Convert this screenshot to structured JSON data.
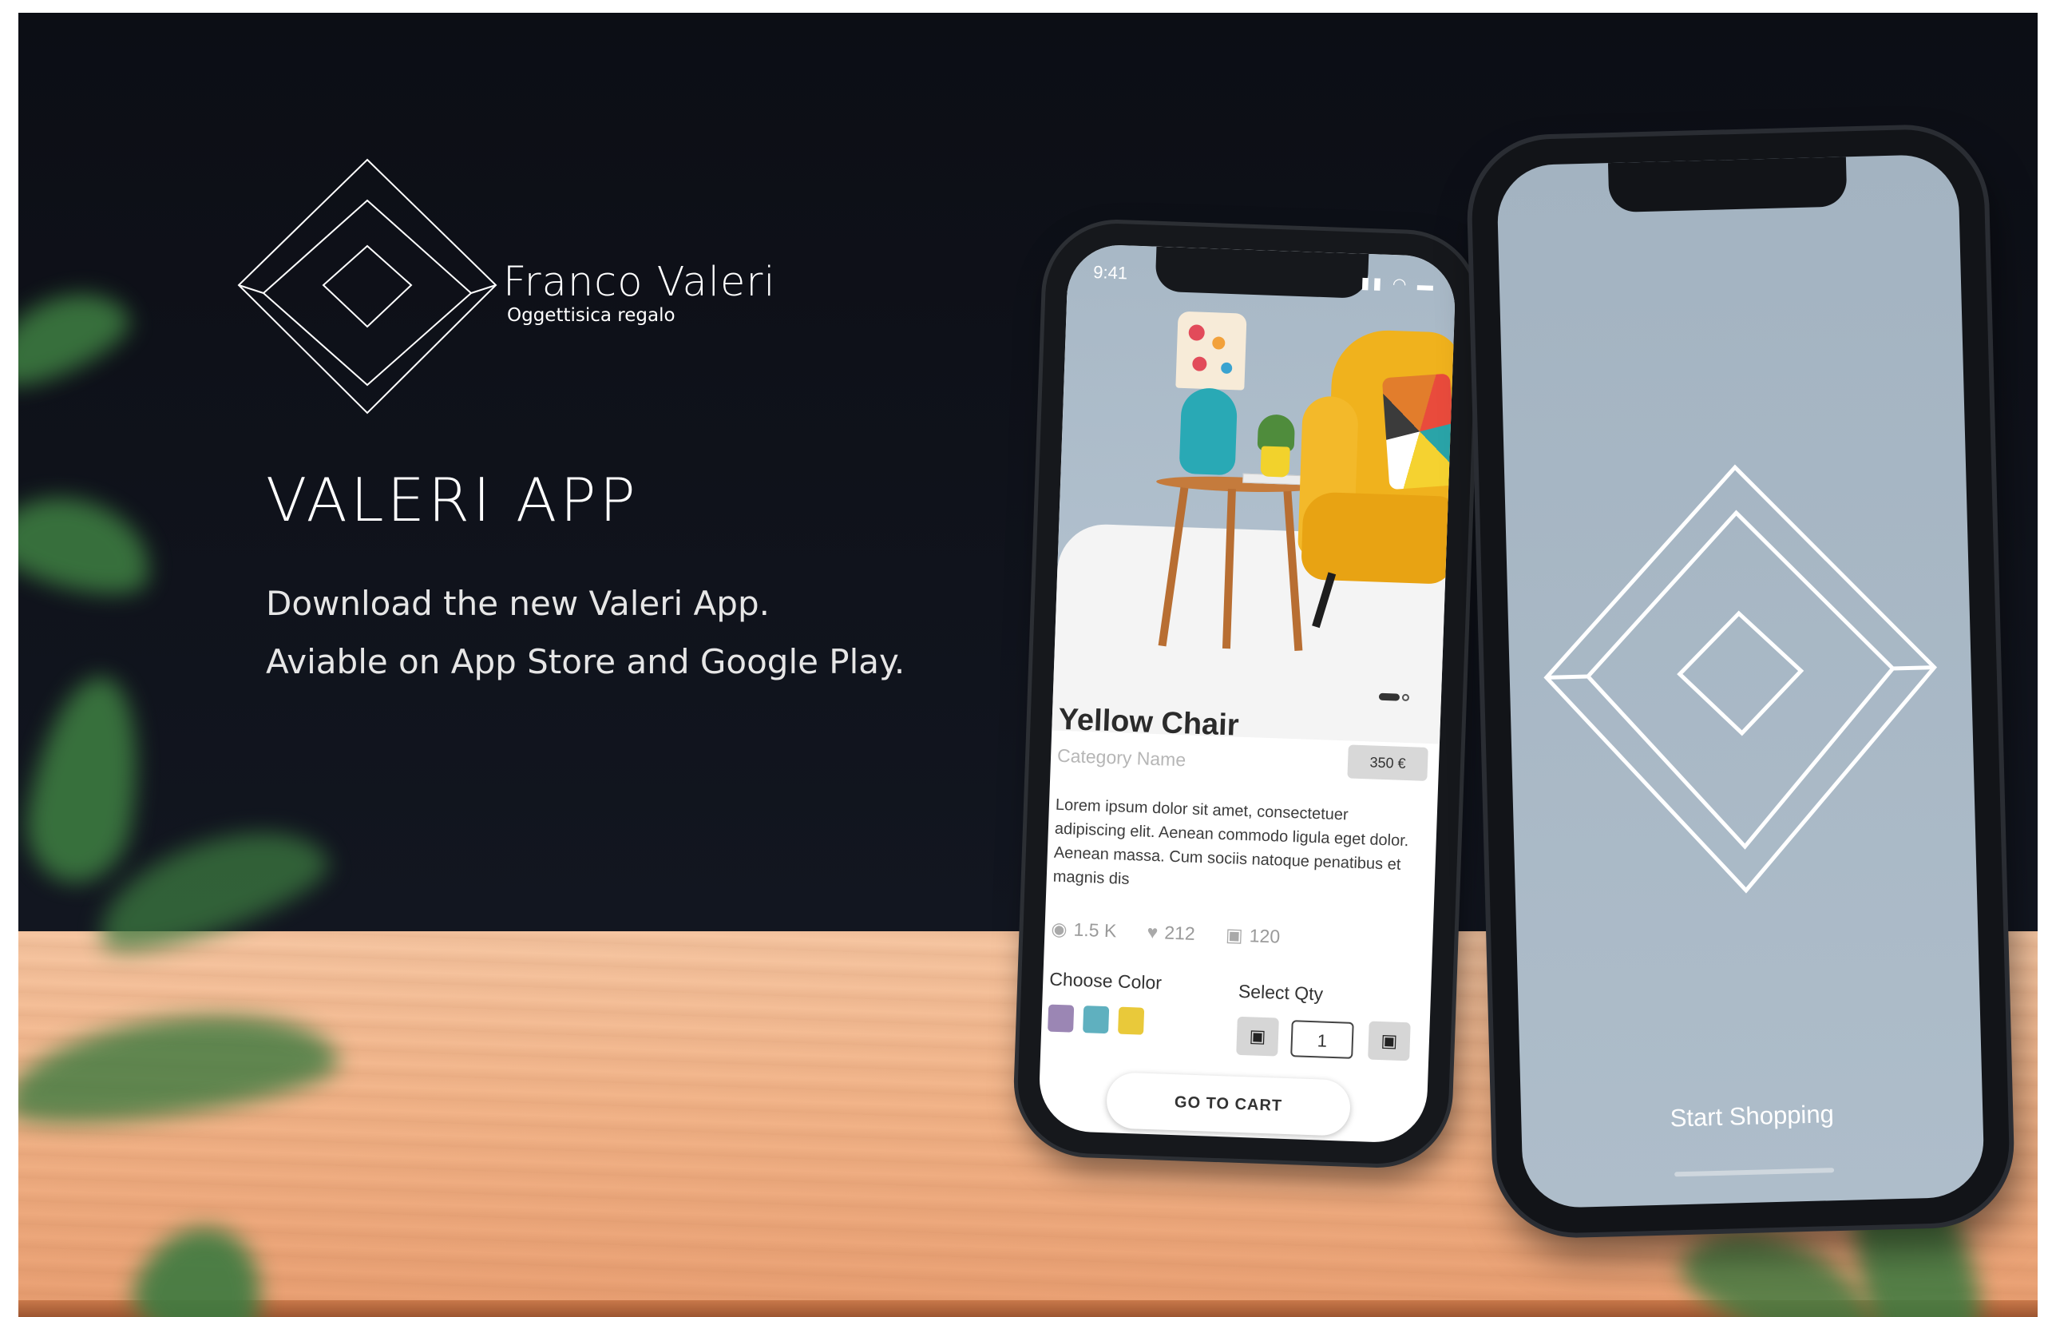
{
  "brand": {
    "name": "Franco Valeri",
    "tagline": "Oggettisica regalo"
  },
  "headline": {
    "title": "VALERI APP",
    "line1": "Download the new Valeri App.",
    "line2": "Aviable on App Store and Google Play."
  },
  "product_screen": {
    "status_time": "9:41",
    "status_icons": "▮▮ ◠ ▬",
    "title": "Yellow Chair",
    "category": "Category Name",
    "price": "350 €",
    "description": "Lorem ipsum dolor sit amet, consectetuer adipiscing elit. Aenean commodo ligula eget dolor. Aenean massa. Cum sociis natoque penatibus et magnis dis",
    "stats": {
      "views": "1.5 K",
      "likes": "212",
      "orders": "120"
    },
    "choose_color_label": "Choose Color",
    "colors": [
      "#9b86b4",
      "#5fb0bf",
      "#e9c93a"
    ],
    "select_qty_label": "Select Qty",
    "qty_value": "1",
    "cart_button": "GO TO CART"
  },
  "splash_screen": {
    "cta": "Start Shopping"
  },
  "icons": {
    "eye": "eye-icon",
    "heart": "heart-icon",
    "bag": "bag-icon"
  }
}
